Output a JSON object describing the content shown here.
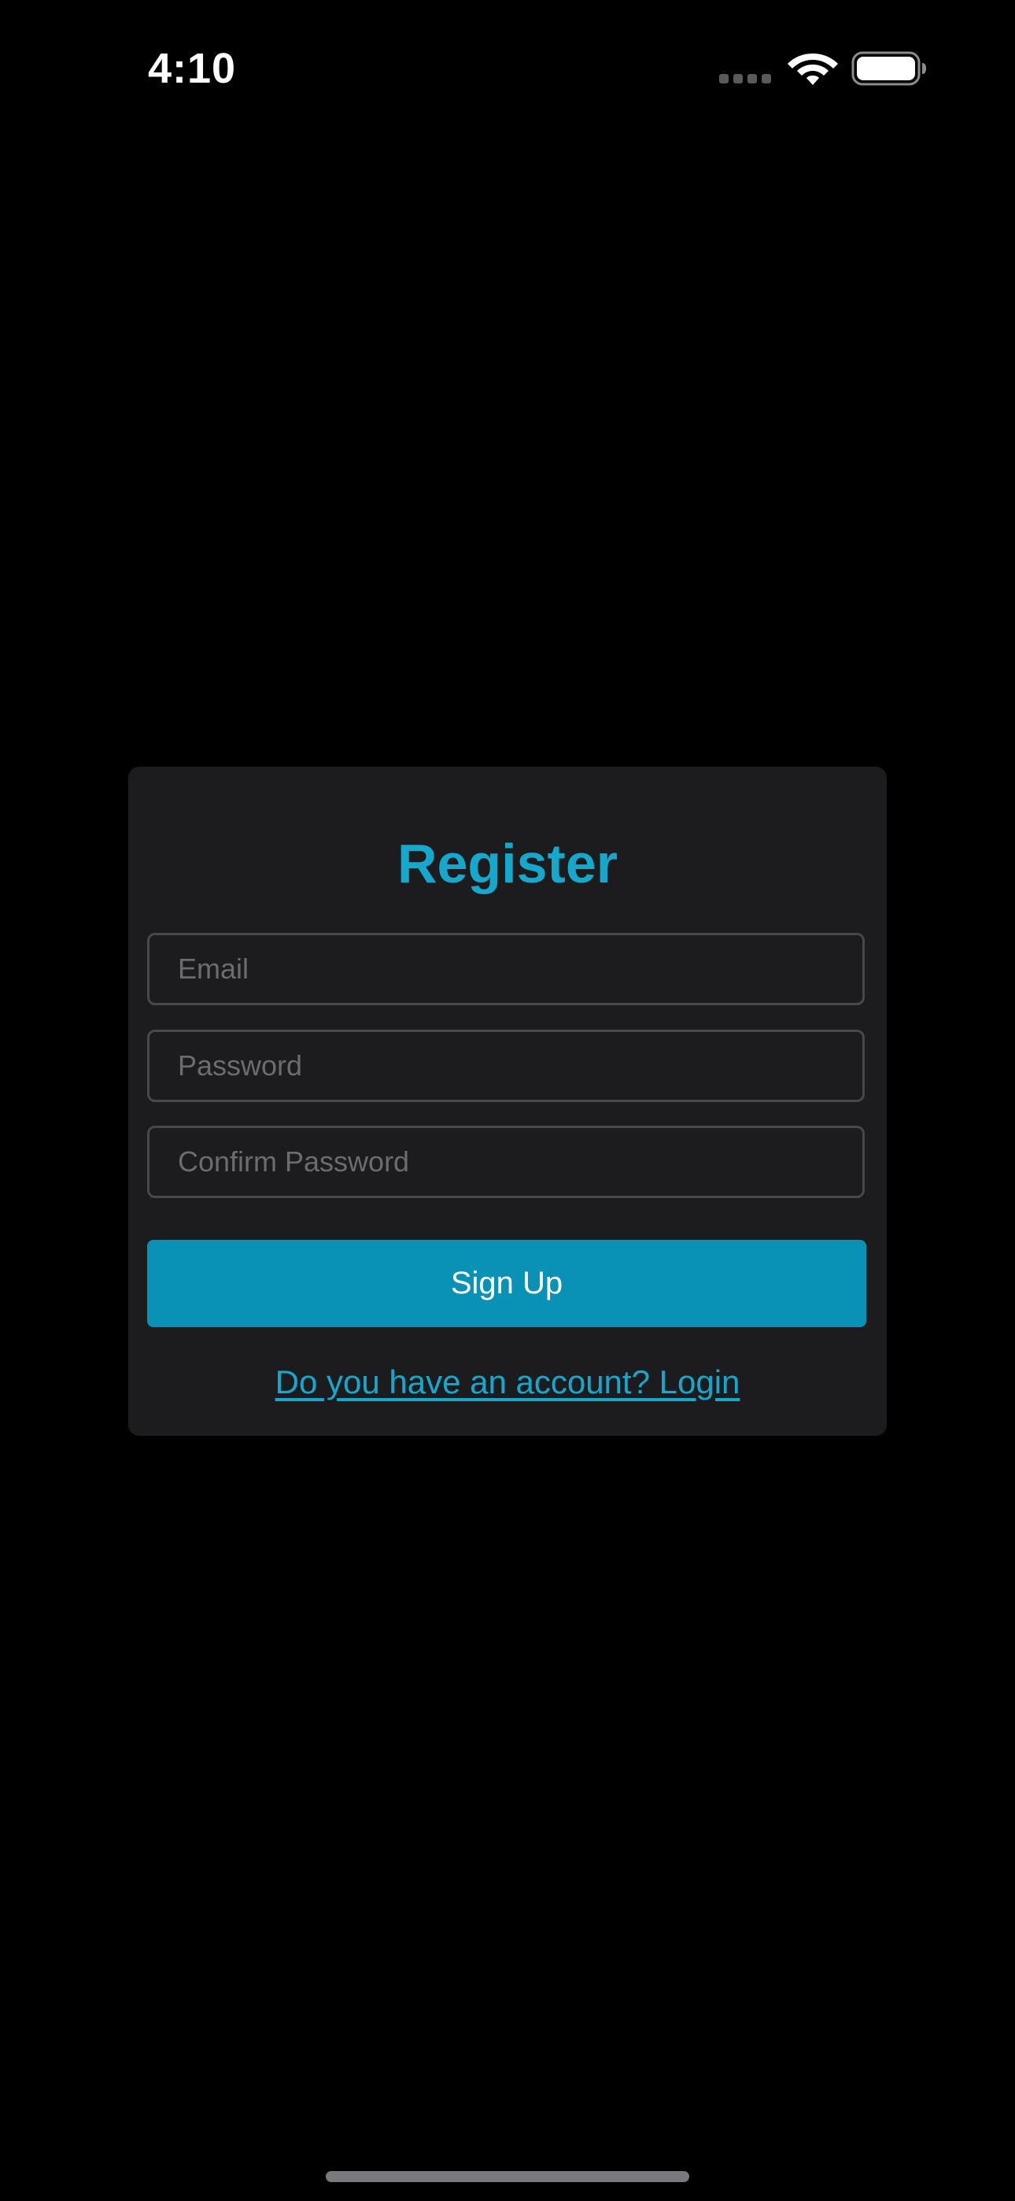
{
  "status_bar": {
    "time": "4:10",
    "signal_icon": "cellular-signal-icon",
    "wifi_icon": "wifi-icon",
    "battery_icon": "battery-icon"
  },
  "register_card": {
    "title": "Register",
    "fields": {
      "email": {
        "placeholder": "Email",
        "value": ""
      },
      "password": {
        "placeholder": "Password",
        "value": ""
      },
      "confirm_password": {
        "placeholder": "Confirm Password",
        "value": ""
      }
    },
    "signup_label": "Sign Up",
    "login_link": "Do you have an account? Login"
  },
  "colors": {
    "background": "#000000",
    "card": "#1c1c1e",
    "accent": "#15a8cc",
    "button": "#0a92b6",
    "field_border": "#48484a",
    "placeholder": "#6b6b70"
  }
}
